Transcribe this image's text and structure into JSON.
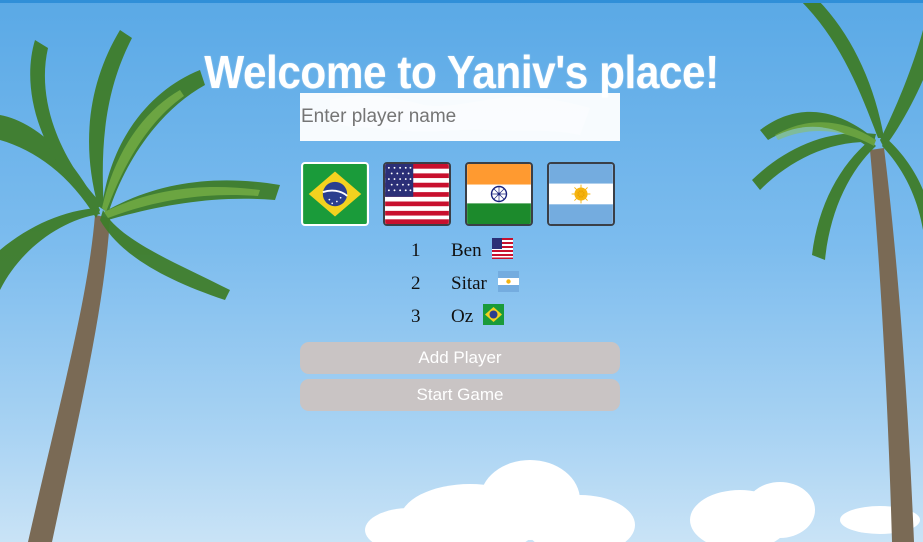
{
  "header": {
    "title": "Welcome to Yaniv's place!"
  },
  "name_input": {
    "placeholder": "Enter player name",
    "value": ""
  },
  "flag_options": [
    {
      "country": "Brazil",
      "icon": "brazil-flag-icon",
      "selected": true
    },
    {
      "country": "United States",
      "icon": "usa-flag-icon",
      "selected": false
    },
    {
      "country": "India",
      "icon": "india-flag-icon",
      "selected": false
    },
    {
      "country": "Argentina",
      "icon": "argentina-flag-icon",
      "selected": false
    }
  ],
  "players": [
    {
      "number": "1",
      "name": "Ben",
      "flag": "usa-flag-icon"
    },
    {
      "number": "2",
      "name": "Sitar",
      "flag": "argentina-flag-icon"
    },
    {
      "number": "3",
      "name": "Oz",
      "flag": "brazil-flag-icon"
    }
  ],
  "actions": {
    "add_player_label": "Add Player",
    "start_game_label": "Start Game"
  },
  "colors": {
    "sky": "#6fb6ea",
    "button_bg": "#c9c4c4",
    "title": "#ffffff"
  }
}
